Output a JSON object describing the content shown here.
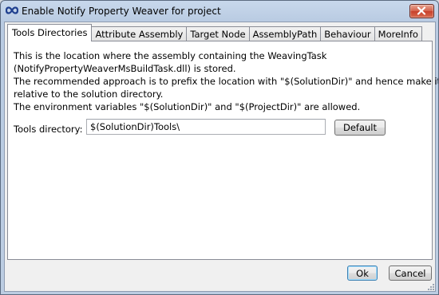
{
  "window": {
    "title": "Enable Notify Property Weaver for project",
    "icon": "infinity-icon",
    "close_icon": "close-icon"
  },
  "tabs": [
    {
      "label": "Tools Directories",
      "active": true
    },
    {
      "label": "Attribute Assembly",
      "active": false
    },
    {
      "label": "Target Node",
      "active": false
    },
    {
      "label": "AssemblyPath",
      "active": false
    },
    {
      "label": "Behaviour",
      "active": false
    },
    {
      "label": "MoreInfo",
      "active": false
    }
  ],
  "panel": {
    "description_lines": [
      "This is the location where the assembly containing the WeavingTask",
      "(NotifyPropertyWeaverMsBuildTask.dll) is stored.",
      "The recommended approach is to prefix the location with \"$(SolutionDir)\" and hence make it",
      "relative to the solution directory.",
      "The environment variables \"$(SolutionDir)\" and \"$(ProjectDir)\" are allowed."
    ],
    "tools_directory_label": "Tools directory:",
    "tools_directory_value": "$(SolutionDir)Tools\\",
    "default_button": "Default"
  },
  "footer": {
    "ok_button": "Ok",
    "cancel_button": "Cancel"
  },
  "colors": {
    "title_gradient_top": "#c8d8ec",
    "close_button": "#c7402b",
    "panel_bg": "#ffffff",
    "client_bg": "#f0f0f0",
    "focus_border": "#3c7fb1"
  }
}
